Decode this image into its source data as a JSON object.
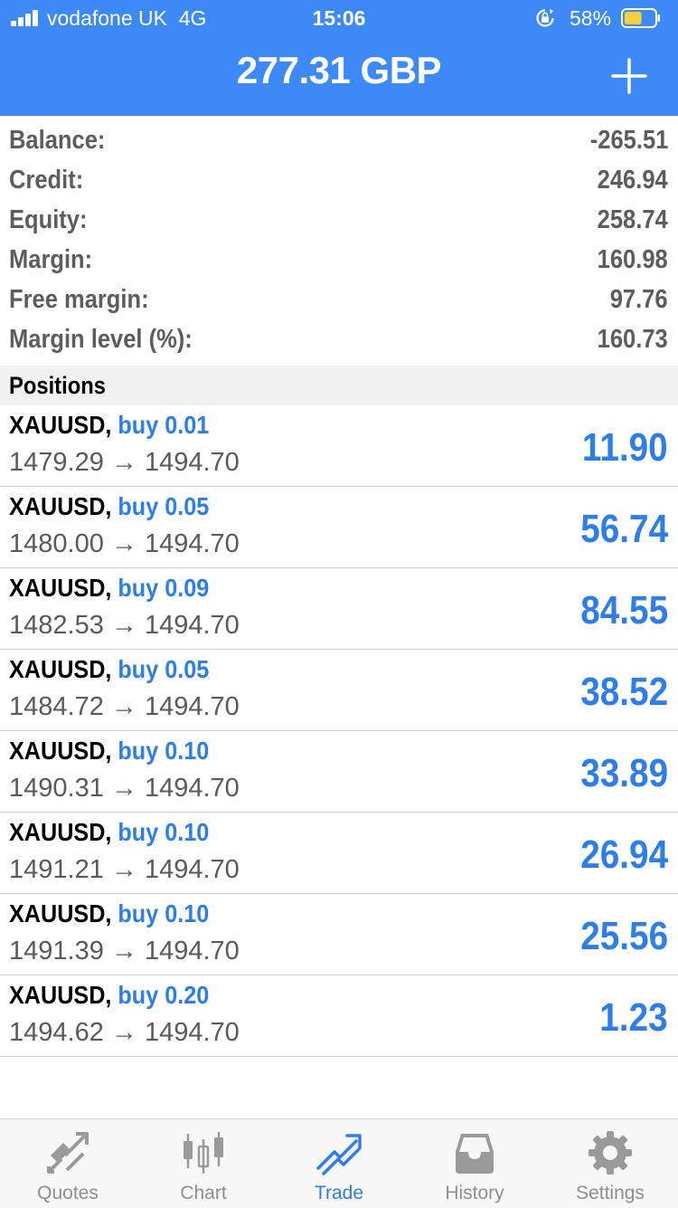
{
  "status_bar": {
    "carrier": "vodafone UK",
    "network": "4G",
    "time": "15:06",
    "battery_percent": "58%",
    "battery_level": 0.58
  },
  "nav": {
    "title": "277.31 GBP"
  },
  "summary": [
    {
      "label": "Balance:",
      "value": "-265.51"
    },
    {
      "label": "Credit:",
      "value": "246.94"
    },
    {
      "label": "Equity:",
      "value": "258.74"
    },
    {
      "label": "Margin:",
      "value": "160.98"
    },
    {
      "label": "Free margin:",
      "value": "97.76"
    },
    {
      "label": "Margin level (%):",
      "value": "160.73"
    }
  ],
  "positions": {
    "header": "Positions",
    "items": [
      {
        "symbol": "XAUUSD,",
        "type": "buy 0.01",
        "open": "1479.29",
        "arrow": "→",
        "current": "1494.70",
        "profit": "11.90"
      },
      {
        "symbol": "XAUUSD,",
        "type": "buy 0.05",
        "open": "1480.00",
        "arrow": "→",
        "current": "1494.70",
        "profit": "56.74"
      },
      {
        "symbol": "XAUUSD,",
        "type": "buy 0.09",
        "open": "1482.53",
        "arrow": "→",
        "current": "1494.70",
        "profit": "84.55"
      },
      {
        "symbol": "XAUUSD,",
        "type": "buy 0.05",
        "open": "1484.72",
        "arrow": "→",
        "current": "1494.70",
        "profit": "38.52"
      },
      {
        "symbol": "XAUUSD,",
        "type": "buy 0.10",
        "open": "1490.31",
        "arrow": "→",
        "current": "1494.70",
        "profit": "33.89"
      },
      {
        "symbol": "XAUUSD,",
        "type": "buy 0.10",
        "open": "1491.21",
        "arrow": "→",
        "current": "1494.70",
        "profit": "26.94"
      },
      {
        "symbol": "XAUUSD,",
        "type": "buy 0.10",
        "open": "1491.39",
        "arrow": "→",
        "current": "1494.70",
        "profit": "25.56"
      },
      {
        "symbol": "XAUUSD,",
        "type": "buy 0.20",
        "open": "1494.62",
        "arrow": "→",
        "current": "1494.70",
        "profit": "1.23"
      }
    ]
  },
  "tabs": [
    {
      "label": "Quotes",
      "icon": "quotes-icon"
    },
    {
      "label": "Chart",
      "icon": "chart-icon"
    },
    {
      "label": "Trade",
      "icon": "trade-icon",
      "active": true
    },
    {
      "label": "History",
      "icon": "history-icon"
    },
    {
      "label": "Settings",
      "icon": "gear-icon"
    }
  ],
  "colors": {
    "header_blue": "#3d8af7",
    "accent_blue": "#2f7ee8",
    "label_gray": "#5d5d5d",
    "tab_inactive": "#8e8e8e",
    "battery_yellow": "#f7d13b"
  }
}
